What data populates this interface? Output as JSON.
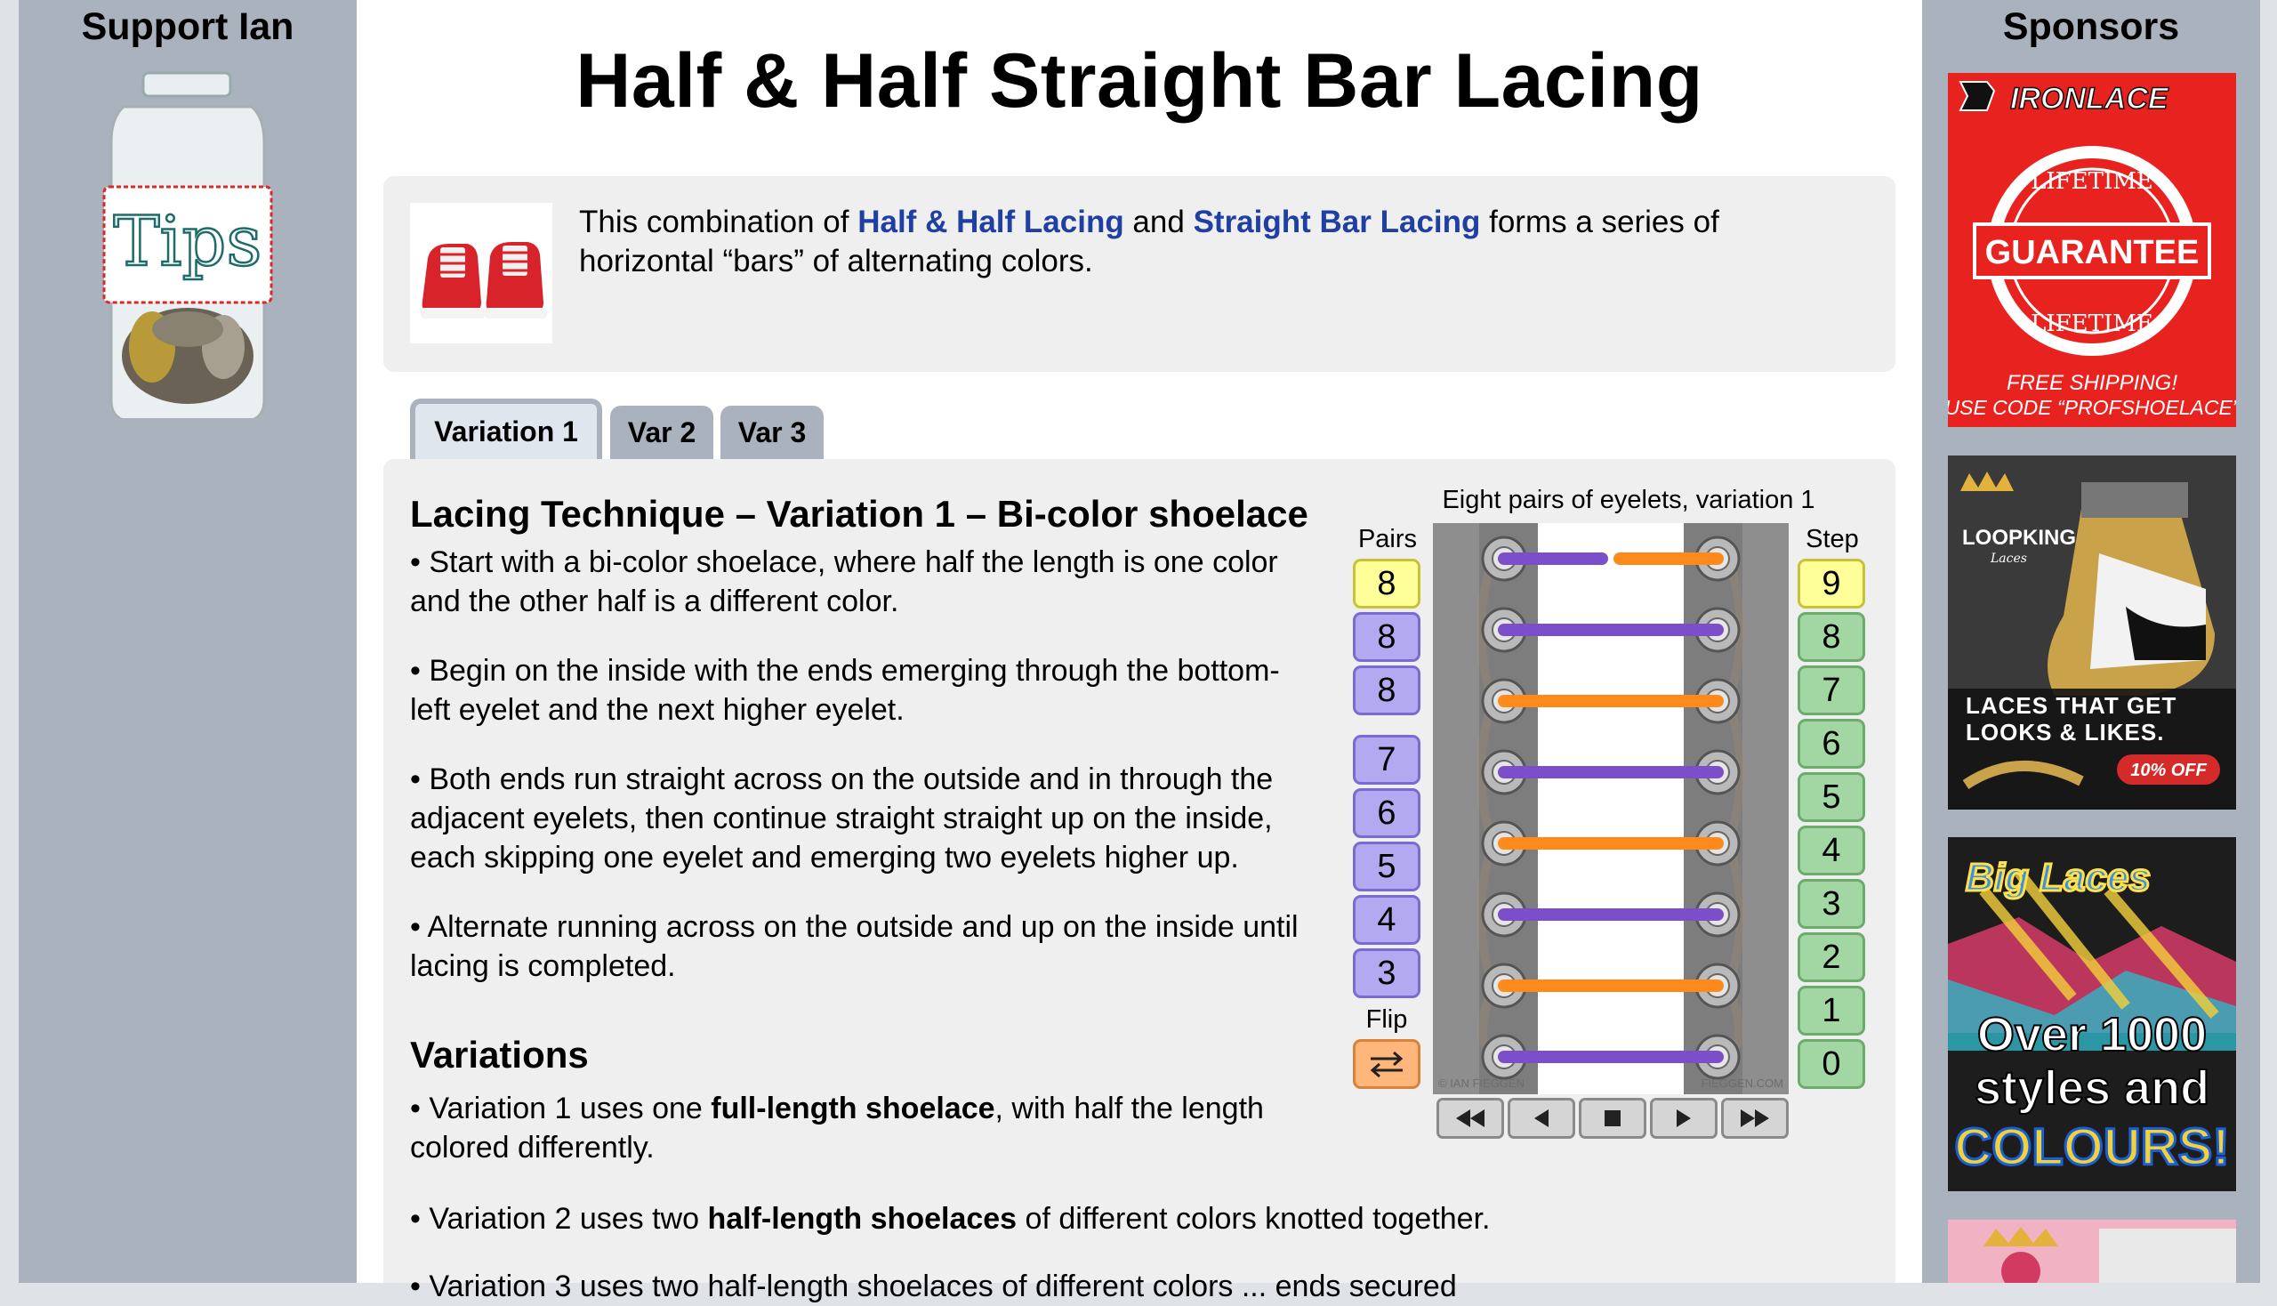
{
  "left_sidebar": {
    "title": "Support Ian",
    "tips_jar_label": "Tips"
  },
  "right_sidebar": {
    "title": "Sponsors",
    "ads": [
      {
        "brand": "IRONLACE",
        "line1": "LIFETIME",
        "line2": "GUARANTEE",
        "line3": "LIFETIME",
        "footer1": "FREE SHIPPING!",
        "footer2": "USE CODE “PROFSHOELACE”",
        "color": "#e8231f"
      },
      {
        "brand": "LOOPKING",
        "sub": "Laces",
        "headline": "LACES THAT GET LOOKS & LIKES.",
        "badge": "10% OFF"
      },
      {
        "brand": "Big Laces",
        "line1": "Over 1000",
        "line2": "styles and",
        "line3": "COLOURS!"
      },
      {
        "brand": ""
      }
    ]
  },
  "page": {
    "title": "Half & Half Straight Bar Lacing",
    "intro": {
      "text_before": "This combination of ",
      "link1": "Half & Half Lacing",
      "text_mid": " and ",
      "link2": "Straight Bar Lacing",
      "text_after": " forms a series of horizontal “bars” of alternating colors."
    },
    "tabs": [
      {
        "label": "Variation 1",
        "active": true
      },
      {
        "label": "Var 2",
        "active": false
      },
      {
        "label": "Var 3",
        "active": false
      }
    ],
    "technique": {
      "heading": "Lacing Technique – Variation 1 – Bi-color shoelace",
      "p1": "• Start with a bi-color shoelace, where half the length is one color and the other half is a different color.",
      "p2": "• Begin on the inside with the ends emerging through the bottom-left eyelet and the next higher eyelet.",
      "p3": "• Both ends run straight across on the outside and in through the adjacent eyelets, then continue straight straight up on the inside, each skipping one eyelet and emerging two eyelets higher up.",
      "p4": "• Alternate running across on the outside and up on the inside until lacing is completed."
    },
    "variations": {
      "heading": "Variations",
      "v1_before": "• Variation 1 uses one ",
      "v1_bold": "full-length shoelace",
      "v1_after": ", with half the length colored differently.",
      "v2_before": "• Variation 2 uses two ",
      "v2_bold": "half-length shoelaces",
      "v2_after": " of different colors knotted together.",
      "v3_partial": "• Variation 3 uses two half-length shoelaces of different colors ... ends secured"
    },
    "diagram": {
      "caption": "Eight pairs of eyelets, variation 1",
      "pairs_label": "Pairs",
      "step_label": "Step",
      "flip_label": "Flip",
      "pairs": [
        "8",
        "8",
        "8",
        "7",
        "6",
        "5",
        "4",
        "3"
      ],
      "steps": [
        "9",
        "8",
        "7",
        "6",
        "5",
        "4",
        "3",
        "2",
        "1",
        "0"
      ],
      "selected_pair_index": 0,
      "selected_step": "9",
      "credit_left": "© IAN FIEGGEN",
      "credit_right": "FIEGGEN.COM",
      "bar_colors": [
        "purple",
        "purple",
        "orange",
        "purple",
        "orange",
        "purple",
        "orange",
        "purple"
      ],
      "purple": "#7a4fc9",
      "orange": "#ff8a1c",
      "controls": [
        "rewind-icon",
        "step-back-icon",
        "stop-icon",
        "step-forward-icon",
        "fast-forward-icon"
      ]
    }
  }
}
